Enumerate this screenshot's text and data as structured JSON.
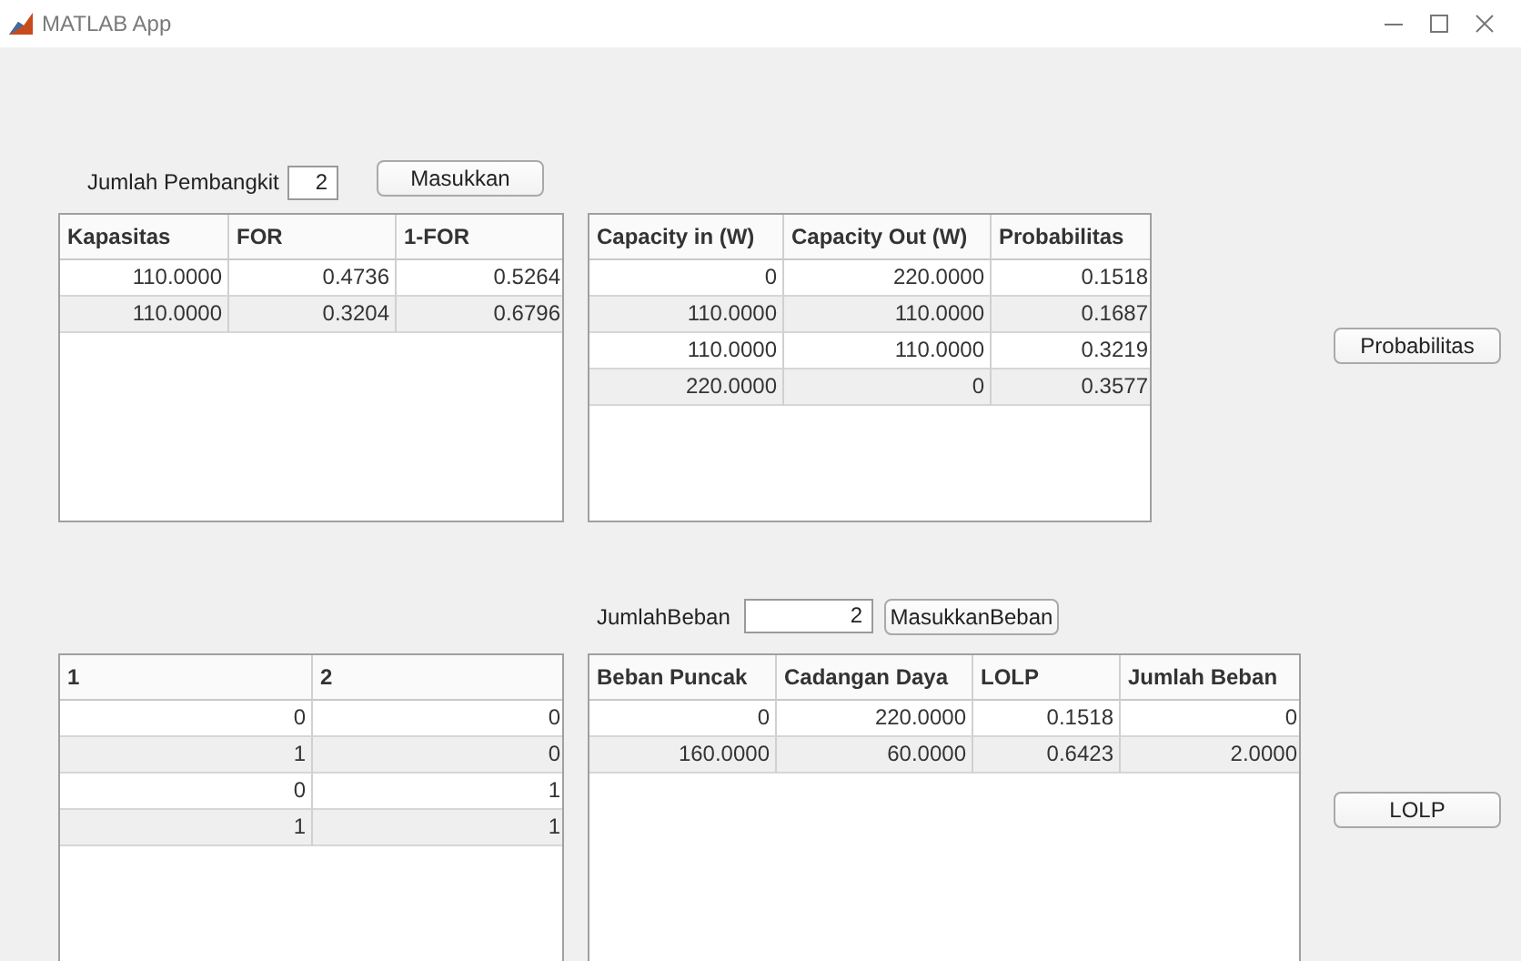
{
  "window": {
    "title": "MATLAB App"
  },
  "generator_input": {
    "label": "Jumlah Pembangkit",
    "value": "2",
    "button": "Masukkan"
  },
  "generator_table": {
    "columns": [
      "Kapasitas",
      "FOR",
      "1-FOR"
    ],
    "rows": [
      [
        "110.0000",
        "0.4736",
        "0.5264"
      ],
      [
        "110.0000",
        "0.3204",
        "0.6796"
      ]
    ]
  },
  "probability_table": {
    "columns": [
      "Capacity in (W)",
      "Capacity Out (W)",
      "Probabilitas"
    ],
    "rows": [
      [
        "0",
        "220.0000",
        "0.1518"
      ],
      [
        "110.0000",
        "110.0000",
        "0.1687"
      ],
      [
        "110.0000",
        "110.0000",
        "0.3219"
      ],
      [
        "220.0000",
        "0",
        "0.3577"
      ]
    ]
  },
  "probability_button": "Probabilitas",
  "load_input": {
    "label": "JumlahBeban",
    "value": "2",
    "button": "MasukkanBeban"
  },
  "state_table": {
    "columns": [
      "1",
      "2"
    ],
    "rows": [
      [
        "0",
        "0"
      ],
      [
        "1",
        "0"
      ],
      [
        "0",
        "1"
      ],
      [
        "1",
        "1"
      ]
    ]
  },
  "lolp_table": {
    "columns": [
      "Beban Puncak",
      "Cadangan Daya",
      "LOLP",
      "Jumlah Beban"
    ],
    "rows": [
      [
        "0",
        "220.0000",
        "0.1518",
        "0"
      ],
      [
        "160.0000",
        "60.0000",
        "0.6423",
        "2.0000"
      ]
    ]
  },
  "lolp_button": "LOLP"
}
